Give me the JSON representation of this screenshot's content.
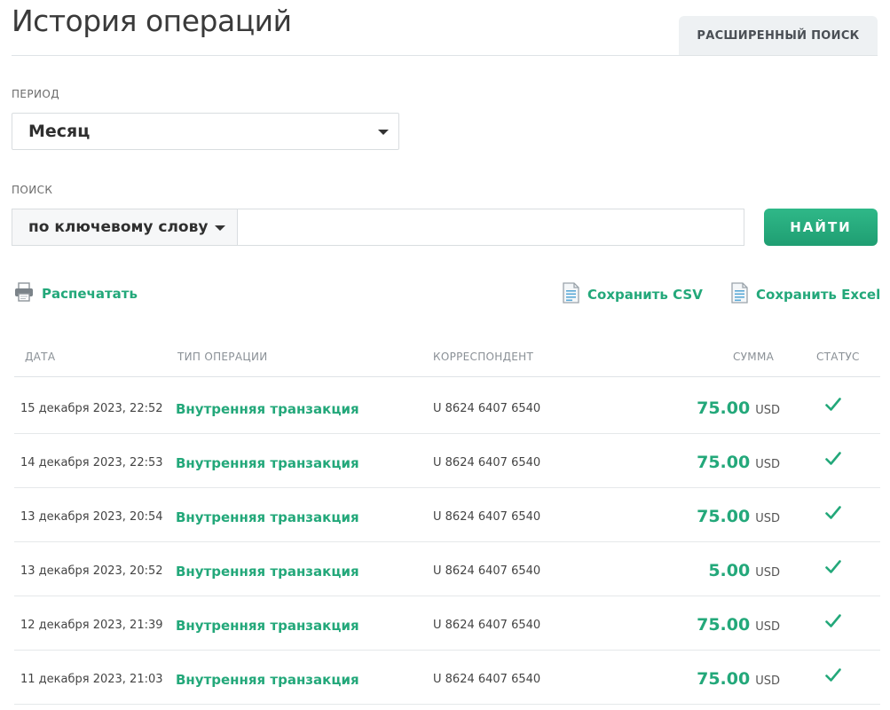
{
  "header": {
    "title": "История операций",
    "advanced_search_label": "РАСШИРЕННЫЙ ПОИСК"
  },
  "period": {
    "label": "ПЕРИОД",
    "value": "Месяц"
  },
  "search": {
    "label": "ПОИСК",
    "type_value": "по ключевому слову",
    "query_value": "",
    "placeholder": "",
    "submit_label": "НАЙТИ"
  },
  "actions": {
    "print_label": "Распечатать",
    "save_csv_label": "Сохранить CSV",
    "save_excel_label": "Сохранить Excel"
  },
  "table": {
    "columns": {
      "date": "ДАТА",
      "type": "ТИП ОПЕРАЦИИ",
      "correspondent": "КОРРЕСПОНДЕНТ",
      "amount": "СУММА",
      "status": "СТАТУС"
    },
    "rows": [
      {
        "date": "15 декабря 2023, 22:52",
        "type": "Внутренняя транзакция",
        "correspondent": "U 8624 6407 6540",
        "amount": "75.00",
        "currency": "USD",
        "status": "completed"
      },
      {
        "date": "14 декабря 2023, 22:53",
        "type": "Внутренняя транзакция",
        "correspondent": "U 8624 6407 6540",
        "amount": "75.00",
        "currency": "USD",
        "status": "completed"
      },
      {
        "date": "13 декабря 2023, 20:54",
        "type": "Внутренняя транзакция",
        "correspondent": "U 8624 6407 6540",
        "amount": "75.00",
        "currency": "USD",
        "status": "completed"
      },
      {
        "date": "13 декабря 2023, 20:52",
        "type": "Внутренняя транзакция",
        "correspondent": "U 8624 6407 6540",
        "amount": "5.00",
        "currency": "USD",
        "status": "completed"
      },
      {
        "date": "12 декабря 2023, 21:39",
        "type": "Внутренняя транзакция",
        "correspondent": "U 8624 6407 6540",
        "amount": "75.00",
        "currency": "USD",
        "status": "completed"
      },
      {
        "date": "11 декабря 2023, 21:03",
        "type": "Внутренняя транзакция",
        "correspondent": "U 8624 6407 6540",
        "amount": "75.00",
        "currency": "USD",
        "status": "completed"
      }
    ]
  },
  "colors": {
    "accent": "#23a87a",
    "button": "#22a679",
    "text": "#333333",
    "muted": "#8a9096"
  },
  "icons": {
    "print": "printer-icon",
    "csv": "document-icon",
    "excel": "document-icon",
    "status": "checkmark-icon",
    "dropdown": "caret-down-icon"
  }
}
